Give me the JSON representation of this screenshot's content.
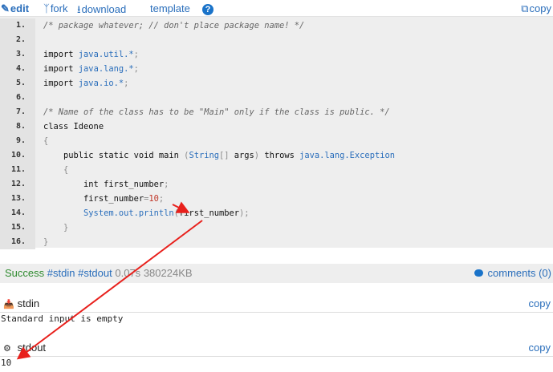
{
  "toolbar": {
    "edit": "edit",
    "fork": "fork",
    "download": "download",
    "template": "template",
    "help": "?",
    "copy": "copy"
  },
  "code": {
    "lines": [
      {
        "n": "1.",
        "tokens": [
          {
            "t": "cmt",
            "v": "/* package whatever; // don't place package name! */"
          }
        ]
      },
      {
        "n": "2.",
        "tokens": []
      },
      {
        "n": "3.",
        "tokens": [
          {
            "t": "kw",
            "v": "import "
          },
          {
            "t": "id",
            "v": "java.util.*"
          },
          {
            "t": "pn",
            "v": ";"
          }
        ]
      },
      {
        "n": "4.",
        "tokens": [
          {
            "t": "kw",
            "v": "import "
          },
          {
            "t": "id",
            "v": "java.lang.*"
          },
          {
            "t": "pn",
            "v": ";"
          }
        ]
      },
      {
        "n": "5.",
        "tokens": [
          {
            "t": "kw",
            "v": "import "
          },
          {
            "t": "id",
            "v": "java.io.*"
          },
          {
            "t": "pn",
            "v": ";"
          }
        ]
      },
      {
        "n": "6.",
        "tokens": []
      },
      {
        "n": "7.",
        "tokens": [
          {
            "t": "cmt",
            "v": "/* Name of the class has to be \"Main\" only if the class is public. */"
          }
        ]
      },
      {
        "n": "8.",
        "tokens": [
          {
            "t": "kw",
            "v": "class Ideone"
          }
        ]
      },
      {
        "n": "9.",
        "tokens": [
          {
            "t": "pn",
            "v": "{"
          }
        ]
      },
      {
        "n": "10.",
        "tokens": [
          {
            "t": "kw",
            "v": "    public static void main "
          },
          {
            "t": "pn",
            "v": "("
          },
          {
            "t": "id",
            "v": "String"
          },
          {
            "t": "pn",
            "v": "[] "
          },
          {
            "t": "kw",
            "v": "args"
          },
          {
            "t": "pn",
            "v": ") "
          },
          {
            "t": "kw",
            "v": "throws "
          },
          {
            "t": "id",
            "v": "java.lang.Exception"
          }
        ]
      },
      {
        "n": "11.",
        "tokens": [
          {
            "t": "pn",
            "v": "    {"
          }
        ]
      },
      {
        "n": "12.",
        "tokens": [
          {
            "t": "kw",
            "v": "        int first_number"
          },
          {
            "t": "pn",
            "v": ";"
          }
        ]
      },
      {
        "n": "13.",
        "tokens": [
          {
            "t": "kw",
            "v": "        first_number"
          },
          {
            "t": "pn",
            "v": "="
          },
          {
            "t": "num",
            "v": "10"
          },
          {
            "t": "pn",
            "v": ";"
          }
        ]
      },
      {
        "n": "14.",
        "tokens": [
          {
            "t": "id",
            "v": "        System.out.println"
          },
          {
            "t": "pn",
            "v": "("
          },
          {
            "t": "kw",
            "v": "first_number"
          },
          {
            "t": "pn",
            "v": ");"
          }
        ]
      },
      {
        "n": "15.",
        "tokens": [
          {
            "t": "pn",
            "v": "    }"
          }
        ]
      },
      {
        "n": "16.",
        "tokens": [
          {
            "t": "pn",
            "v": "}"
          }
        ]
      }
    ]
  },
  "status": {
    "result": "Success",
    "stdin_link": "#stdin",
    "stdout_link": "#stdout",
    "time": "0.07s",
    "memory": "380224KB",
    "comments": "comments (0)"
  },
  "stdin": {
    "title": "stdin",
    "copy": "copy",
    "content": "Standard input is empty"
  },
  "stdout": {
    "title": "stdout",
    "copy": "copy",
    "content": "10"
  },
  "colors": {
    "link": "#2a6ebb",
    "success": "#2e8b2e",
    "annotation_arrow": "#e8201c"
  },
  "icons": {
    "edit": "pencil-icon",
    "fork": "fork-icon",
    "download": "download-icon",
    "help": "help-icon",
    "copy": "copy-icon",
    "comments": "speech-bubble-icon",
    "stdin": "inbox-icon",
    "stdout": "gears-icon"
  }
}
